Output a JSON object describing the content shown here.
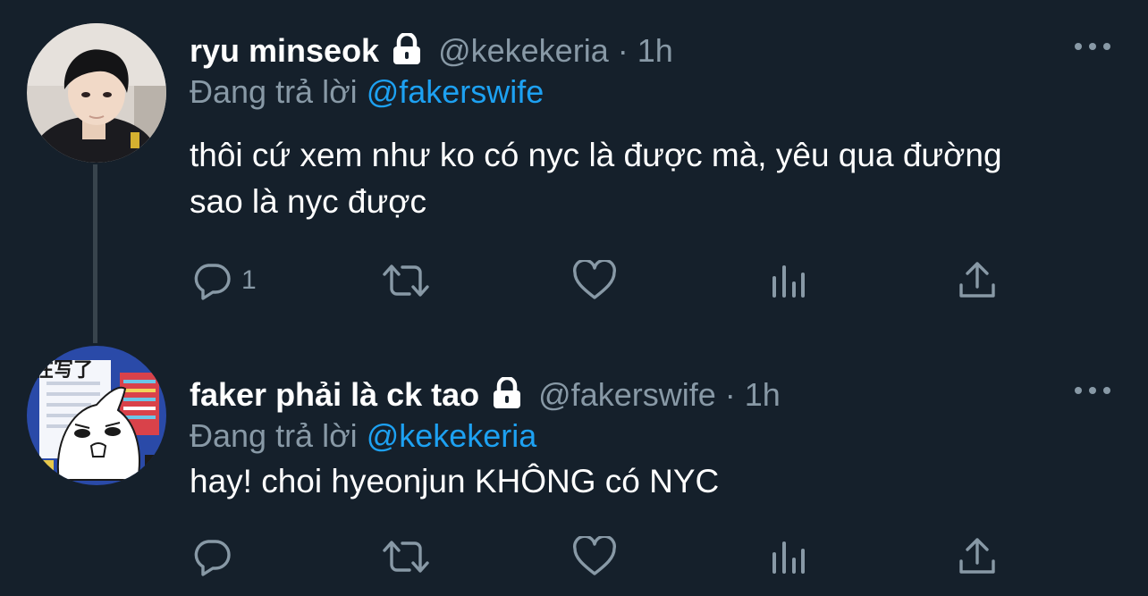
{
  "tweets": [
    {
      "name": "ryu minseok",
      "handle": "@kekekeria",
      "separator": "·",
      "time": "1h",
      "replying_prefix": "Đang trả lời",
      "replying_to": "@fakerswife",
      "text": "thôi cứ xem như ko có nyc là được mà, yêu qua đường sao là nyc được",
      "reply_count": "1",
      "icons": [
        "reply-icon",
        "retweet-icon",
        "like-icon",
        "analytics-icon",
        "share-icon",
        "more-icon",
        "lock-icon"
      ]
    },
    {
      "name": "faker phải là ck tao",
      "handle": "@fakerswife",
      "separator": "·",
      "time": "1h",
      "replying_prefix": "Đang trả lời",
      "replying_to": "@kekekeria",
      "text": "hay! choi hyeonjun KHÔNG có NYC",
      "reply_count": "",
      "avatar_text": "在写了",
      "icons": [
        "reply-icon",
        "retweet-icon",
        "like-icon",
        "analytics-icon",
        "share-icon",
        "more-icon",
        "lock-icon"
      ]
    }
  ],
  "colors": {
    "background": "#15202b",
    "primary_text": "#ffffff",
    "secondary_text": "#8899a6",
    "link": "#1da1f2",
    "thread_line": "#38444d"
  }
}
